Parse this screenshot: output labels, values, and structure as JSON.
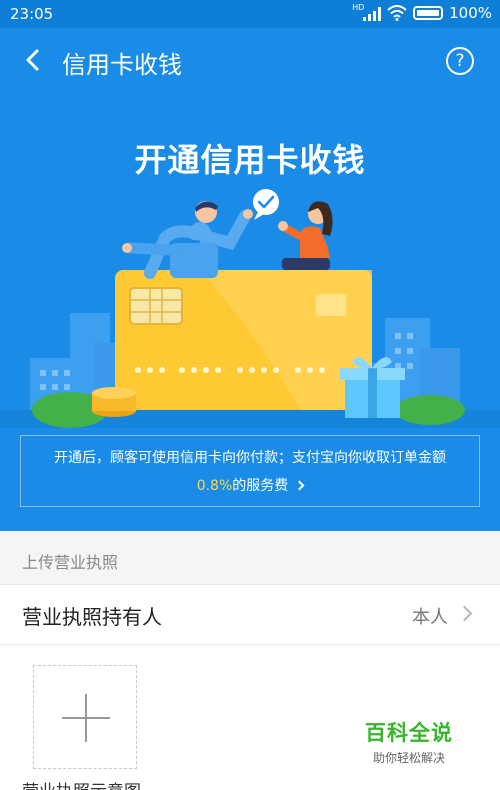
{
  "status_bar": {
    "time": "23:05",
    "network_label": "HD",
    "battery": "100%"
  },
  "nav": {
    "title": "信用卡收钱",
    "help_glyph": "?"
  },
  "hero": {
    "title": "开通信用卡收钱",
    "illustration": "people-credit-card-illustration",
    "info_line1": "开通后，顾客可使用信用卡向你付款；支付宝向你收取订单金额",
    "fee_rate": "0.8%",
    "fee_suffix": "的服务费"
  },
  "section": {
    "header": "上传营业执照"
  },
  "holder_row": {
    "label": "营业执照持有人",
    "value": "本人"
  },
  "upload": {
    "caption": "营业执照示意图"
  },
  "watermark": {
    "main": "百科全说",
    "sub": "助你轻松解决"
  },
  "colors": {
    "hero_blue": "#1a8ce8",
    "status_blue": "#0f7ed6",
    "fee_highlight": "#ffd84d",
    "card_yellow": "#ffc933",
    "watermark_green": "#38b62a"
  }
}
